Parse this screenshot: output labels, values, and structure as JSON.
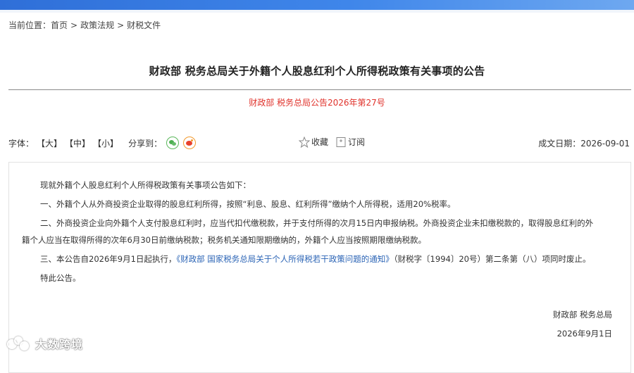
{
  "header": {
    "bar_color": "#3577e0"
  },
  "breadcrumb": {
    "label": "当前位置：",
    "items": [
      "首页",
      "政策法规",
      "财税文件"
    ],
    "separator": ">"
  },
  "article": {
    "title": "财政部 税务总局关于外籍个人股息红利个人所得税政策有关事项的公告",
    "doc_number": "财政部 税务总局公告2026年第27号",
    "doc_number_color": "#e0322b"
  },
  "toolbar": {
    "font_label": "字体：",
    "font_large": "【大】",
    "font_medium": "【中】",
    "font_small": "【小】",
    "share_label": "分享到：",
    "share_icons": [
      "wechat-icon",
      "weibo-icon"
    ],
    "favorite_label": "收藏",
    "subscribe_label": "订阅",
    "date_label": "成文日期：",
    "date_value": "2026-09-01"
  },
  "body": {
    "intro": "现就外籍个人股息红利个人所得税政策有关事项公告如下：",
    "item1": "一、外籍个人从外商投资企业取得的股息红利所得，按照“利息、股息、红利所得”缴纳个人所得税，适用20%税率。",
    "item2_line1": "二、外商投资企业向外籍个人支付股息红利时，应当代扣代缴税款，并于支付所得的次月15日内申报纳税。外商投资企业未扣缴税款的，取得股息红利的外",
    "item2_line2": "籍个人应当在取得所得的次年6月30日前缴纳税款；税务机关通知限期缴纳的，外籍个人应当按照期限缴纳税款。",
    "item3_prefix": "三、本公告自2026年9月1日起执行，",
    "item3_link": "《财政部 国家税务总局关于个人所得税若干政策问题的通知》",
    "item3_suffix": "（财税字〔1994〕20号）第二条第（八）项同时废止。",
    "closing": "特此公告。",
    "signatory": "财政部 税务总局",
    "sign_date": "2026年9月1日",
    "link_color": "#2a63b5"
  },
  "watermark": {
    "text": "大数跨境"
  }
}
